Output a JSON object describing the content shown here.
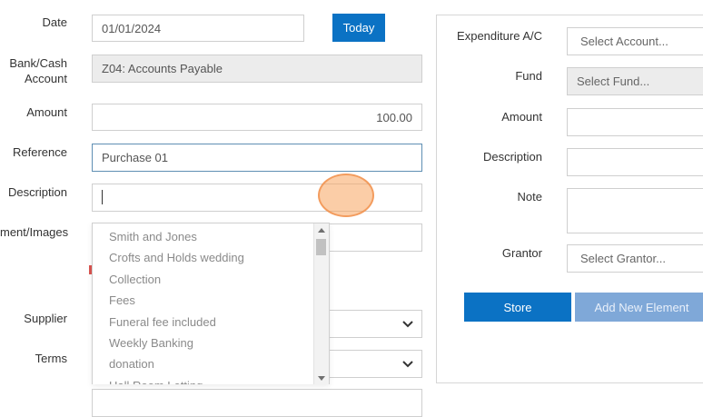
{
  "left_form": {
    "date": {
      "label": "Date",
      "value": "01/01/2024"
    },
    "today_button": "Today",
    "bank_cash": {
      "label_line1": "Bank/Cash",
      "label_line2": "Account",
      "value": "Z04: Accounts Payable"
    },
    "amount": {
      "label": "Amount",
      "value": "100.00"
    },
    "reference": {
      "label": "Reference",
      "value": "Purchase 01"
    },
    "description": {
      "label": "Description",
      "value": ""
    },
    "attachments": {
      "label": "ment/Images"
    },
    "supplier": {
      "label": "Supplier"
    },
    "terms": {
      "label": "Terms"
    }
  },
  "autocomplete": {
    "items": [
      "Smith and Jones",
      "Crofts and Holds wedding",
      "Collection",
      "Fees",
      "Funeral fee included",
      "Weekly Banking",
      "donation",
      "Hall Room Letting"
    ]
  },
  "right_panel": {
    "expenditure": {
      "label": "Expenditure A/C",
      "placeholder": "Select Account..."
    },
    "fund": {
      "label": "Fund",
      "placeholder": "Select Fund..."
    },
    "amount": {
      "label": "Amount",
      "value": ""
    },
    "description": {
      "label": "Description",
      "value": ""
    },
    "note": {
      "label": "Note",
      "value": ""
    },
    "grantor": {
      "label": "Grantor",
      "placeholder": "Select Grantor..."
    },
    "store_button": "Store",
    "add_button": "Add New Element"
  },
  "colors": {
    "primary": "#0b72c4",
    "disabled": "#7fa8d8",
    "click_indicator": "#f8a45f"
  }
}
